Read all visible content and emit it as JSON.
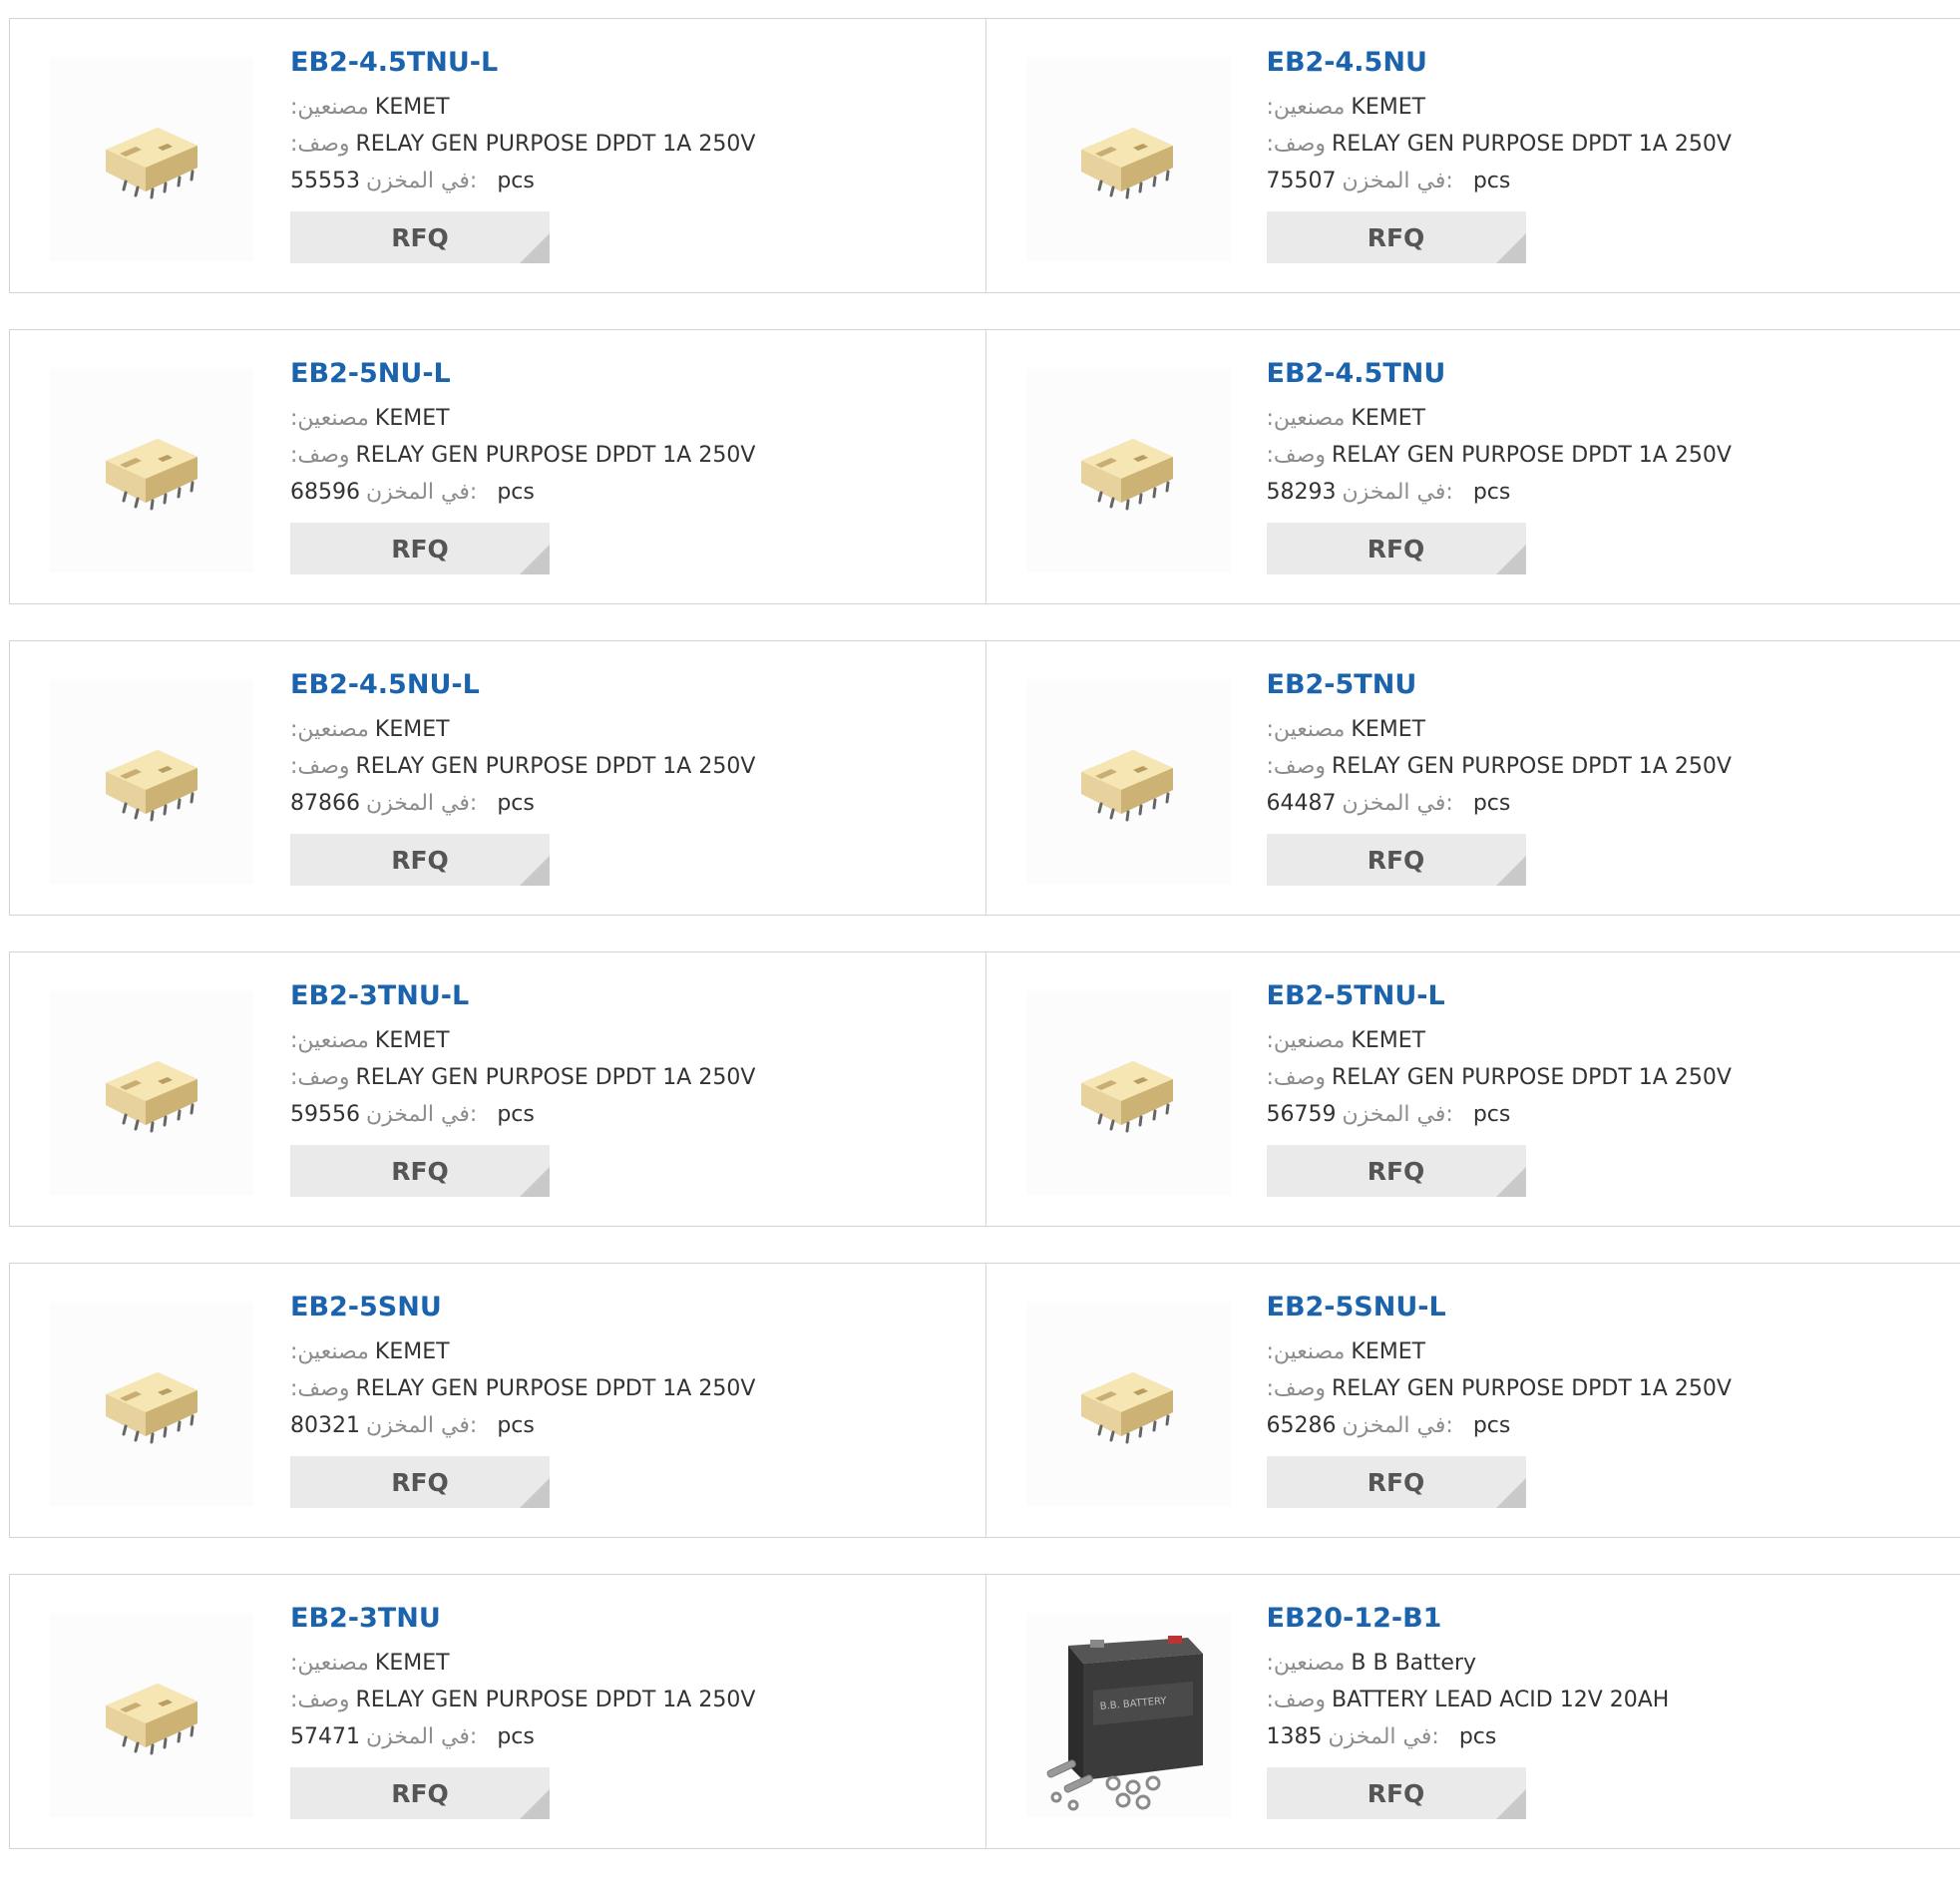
{
  "labels": {
    "manufacturer": ":مصنعين",
    "description": ":وصف",
    "stock": "في المخزن:",
    "pcs": "pcs",
    "rfq": "RFQ"
  },
  "colors": {
    "part_link": "#1b64ad",
    "rfq_bg": "#eaeaea",
    "border": "#d3d3d3"
  },
  "rows": [
    [
      {
        "pn": "EB2-4.5TNU-L",
        "mfr": "KEMET",
        "desc": "RELAY GEN PURPOSE DPDT 1A 250V",
        "stock": "55553",
        "image": "relay"
      },
      {
        "pn": "EB2-4.5NU",
        "mfr": "KEMET",
        "desc": "RELAY GEN PURPOSE DPDT 1A 250V",
        "stock": "75507",
        "image": "relay"
      }
    ],
    [
      {
        "pn": "EB2-5NU-L",
        "mfr": "KEMET",
        "desc": "RELAY GEN PURPOSE DPDT 1A 250V",
        "stock": "68596",
        "image": "relay"
      },
      {
        "pn": "EB2-4.5TNU",
        "mfr": "KEMET",
        "desc": "RELAY GEN PURPOSE DPDT 1A 250V",
        "stock": "58293",
        "image": "relay"
      }
    ],
    [
      {
        "pn": "EB2-4.5NU-L",
        "mfr": "KEMET",
        "desc": "RELAY GEN PURPOSE DPDT 1A 250V",
        "stock": "87866",
        "image": "relay"
      },
      {
        "pn": "EB2-5TNU",
        "mfr": "KEMET",
        "desc": "RELAY GEN PURPOSE DPDT 1A 250V",
        "stock": "64487",
        "image": "relay"
      }
    ],
    [
      {
        "pn": "EB2-3TNU-L",
        "mfr": "KEMET",
        "desc": "RELAY GEN PURPOSE DPDT 1A 250V",
        "stock": "59556",
        "image": "relay"
      },
      {
        "pn": "EB2-5TNU-L",
        "mfr": "KEMET",
        "desc": "RELAY GEN PURPOSE DPDT 1A 250V",
        "stock": "56759",
        "image": "relay"
      }
    ],
    [
      {
        "pn": "EB2-5SNU",
        "mfr": "KEMET",
        "desc": "RELAY GEN PURPOSE DPDT 1A 250V",
        "stock": "80321",
        "image": "relay"
      },
      {
        "pn": "EB2-5SNU-L",
        "mfr": "KEMET",
        "desc": "RELAY GEN PURPOSE DPDT 1A 250V",
        "stock": "65286",
        "image": "relay"
      }
    ],
    [
      {
        "pn": "EB2-3TNU",
        "mfr": "KEMET",
        "desc": "RELAY GEN PURPOSE DPDT 1A 250V",
        "stock": "57471",
        "image": "relay"
      },
      {
        "pn": "EB20-12-B1",
        "mfr": "B B Battery",
        "desc": "BATTERY LEAD ACID 12V 20AH",
        "stock": "1385",
        "image": "battery"
      }
    ]
  ]
}
